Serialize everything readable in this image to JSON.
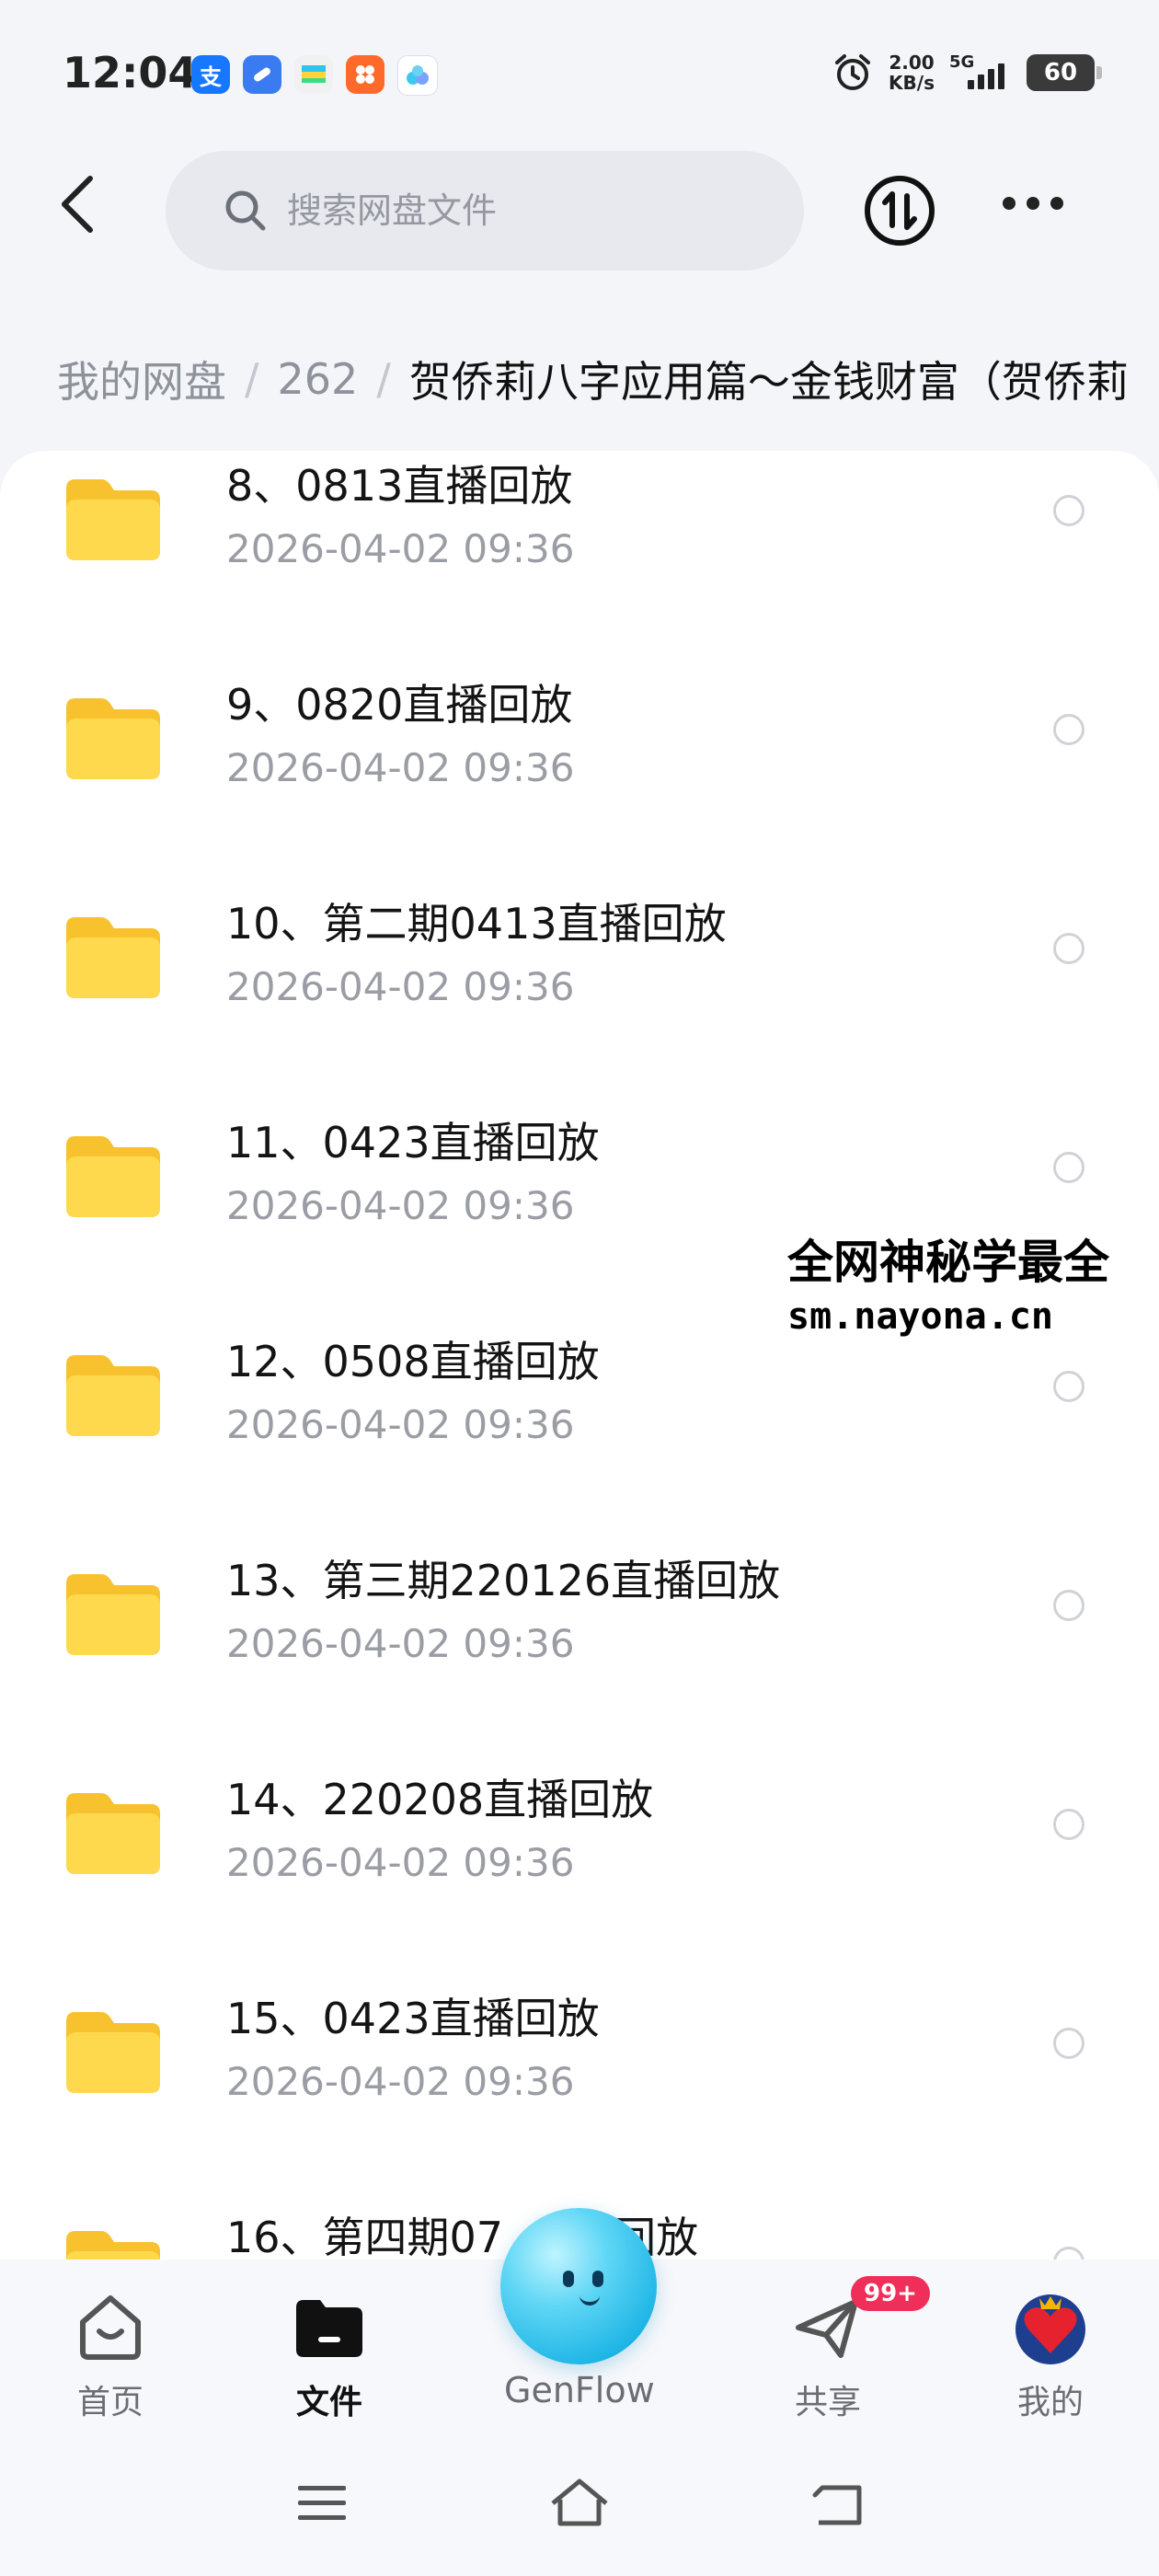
{
  "status_bar": {
    "time": "12:04",
    "apps": [
      {
        "icon": "alipay-icon",
        "glyph": "支",
        "color": "#1677ff"
      },
      {
        "icon": "app-blue-icon",
        "glyph": "",
        "color": "#3b7bf2"
      },
      {
        "icon": "app-card-icon",
        "glyph": "",
        "color": "#f2f2f2"
      },
      {
        "icon": "app-orange-icon",
        "glyph": "",
        "color": "#ff6a2a"
      },
      {
        "icon": "genflow-small-icon",
        "glyph": "",
        "color": "#ffffff"
      }
    ],
    "net_speed_value": "2.00",
    "net_speed_unit": "KB/s",
    "network": "5G",
    "battery": "60"
  },
  "header": {
    "search_placeholder": "搜索网盘文件"
  },
  "breadcrumb": {
    "items": [
      "我的网盘",
      "262"
    ],
    "current": "贺侨莉八字应用篇～金钱财富（贺侨莉"
  },
  "files": [
    {
      "name": "8、0813直播回放",
      "date": "2026-04-02  09:36"
    },
    {
      "name": "9、0820直播回放",
      "date": "2026-04-02  09:36"
    },
    {
      "name": "10、第二期0413直播回放",
      "date": "2026-04-02  09:36"
    },
    {
      "name": "11、0423直播回放",
      "date": "2026-04-02  09:36"
    },
    {
      "name": "12、0508直播回放",
      "date": "2026-04-02  09:36"
    },
    {
      "name": "13、第三期220126直播回放",
      "date": "2026-04-02  09:36"
    },
    {
      "name": "14、220208直播回放",
      "date": "2026-04-02  09:36"
    },
    {
      "name": "15、0423直播回放",
      "date": "2026-04-02  09:36"
    },
    {
      "name": "16、第四期07",
      "name_tail": "回放",
      "date": ""
    }
  ],
  "watermark": {
    "line1": "全网神秘学最全",
    "line2": "sm.nayona.cn"
  },
  "bottom_nav": {
    "home": "首页",
    "files": "文件",
    "genflow": "GenFlow",
    "share": "共享",
    "share_badge": "99+",
    "mine": "我的"
  },
  "colors": {
    "folder": "#ffd54a",
    "badge": "#ef2f5a",
    "genflow": "#3cc8ef"
  }
}
